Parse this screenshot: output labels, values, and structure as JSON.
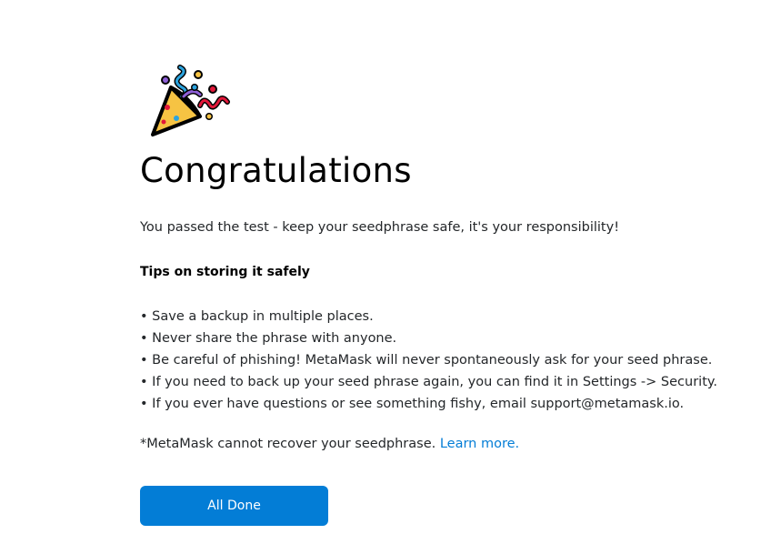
{
  "icon": "party-popper-icon",
  "title": "Congratulations",
  "intro": "You passed the test - keep your seedphrase safe, it's your responsibility!",
  "tips": {
    "heading": "Tips on storing it safely",
    "items": [
      "• Save a backup in multiple places.",
      "• Never share the phrase with anyone.",
      "• Be careful of phishing! MetaMask will never spontaneously ask for your seed phrase.",
      "• If you need to back up your seed phrase again, you can find it in Settings -> Security.",
      "• If you ever have questions or see something fishy, email support@metamask.io."
    ]
  },
  "disclaimer": {
    "text": "*MetaMask cannot recover your seedphrase. ",
    "link_label": "Learn more."
  },
  "button": {
    "label": "All Done"
  },
  "colors": {
    "accent": "#037dd6",
    "text": "#24272a"
  }
}
